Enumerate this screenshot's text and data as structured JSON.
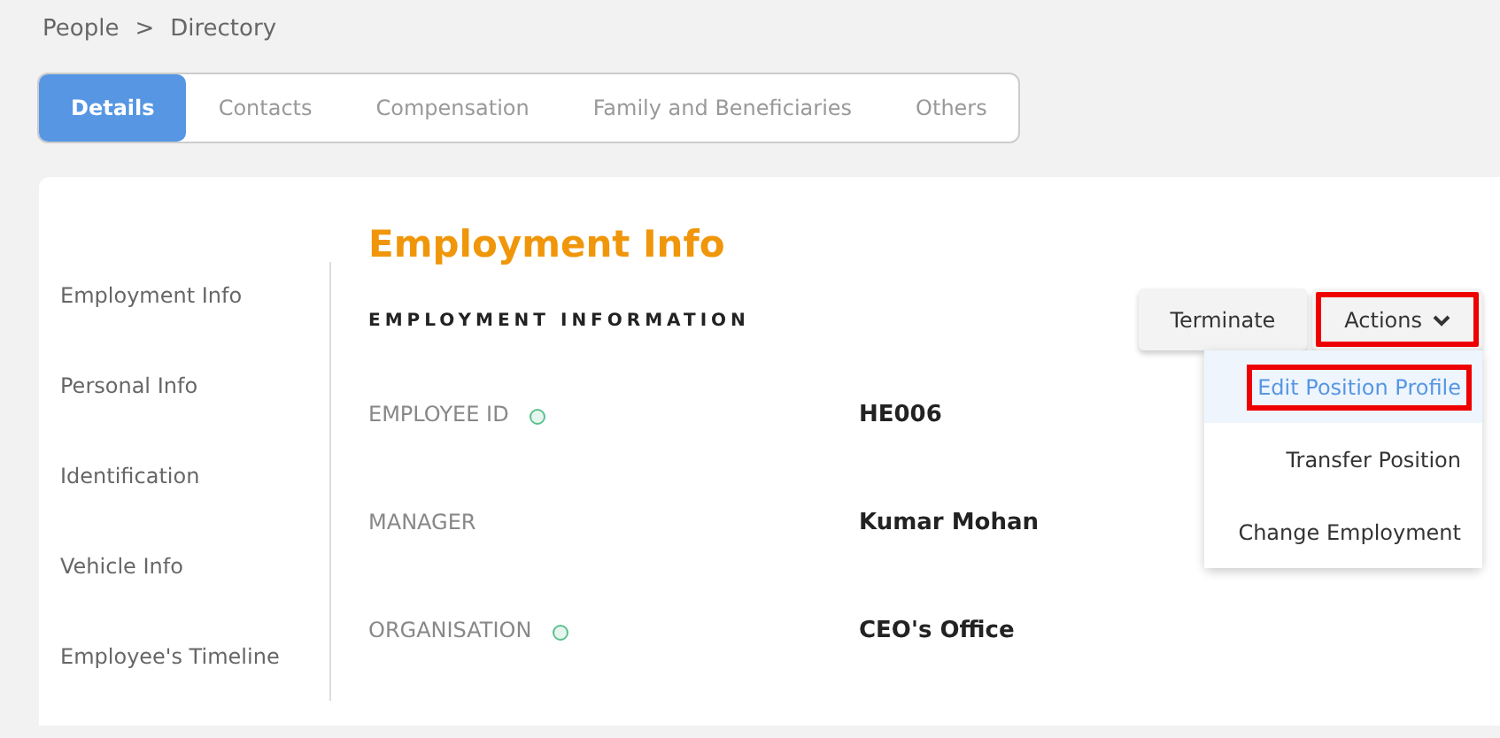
{
  "breadcrumb": {
    "items": [
      "People",
      "Directory"
    ],
    "separator": ">"
  },
  "tabs": [
    {
      "label": "Details",
      "selected": true
    },
    {
      "label": "Contacts",
      "selected": false
    },
    {
      "label": "Compensation",
      "selected": false
    },
    {
      "label": "Family and Beneficiaries",
      "selected": false
    },
    {
      "label": "Others",
      "selected": false
    }
  ],
  "sidebar": {
    "items": [
      "Employment Info",
      "Personal Info",
      "Identification",
      "Vehicle Info",
      "Employee's Timeline"
    ]
  },
  "page_title": "Employment Info",
  "section_heading": "EMPLOYMENT INFORMATION",
  "buttons": [
    {
      "label": "Terminate",
      "kind": "plain",
      "highlighted": false
    },
    {
      "label": "Actions",
      "kind": "dropdown",
      "highlighted": true
    }
  ],
  "actions_menu": [
    {
      "label": "Edit Position Profile",
      "selected": true,
      "highlighted": true
    },
    {
      "label": "Transfer Position",
      "selected": false,
      "highlighted": false
    },
    {
      "label": "Change Employment",
      "selected": false,
      "highlighted": false
    }
  ],
  "fields": [
    {
      "label": "EMPLOYEE ID",
      "value": "HE006",
      "dot": true
    },
    {
      "label": "MANAGER",
      "value": "Kumar Mohan",
      "dot": false
    },
    {
      "label": "ORGANISATION",
      "value": "CEO's Office",
      "dot": true
    }
  ]
}
